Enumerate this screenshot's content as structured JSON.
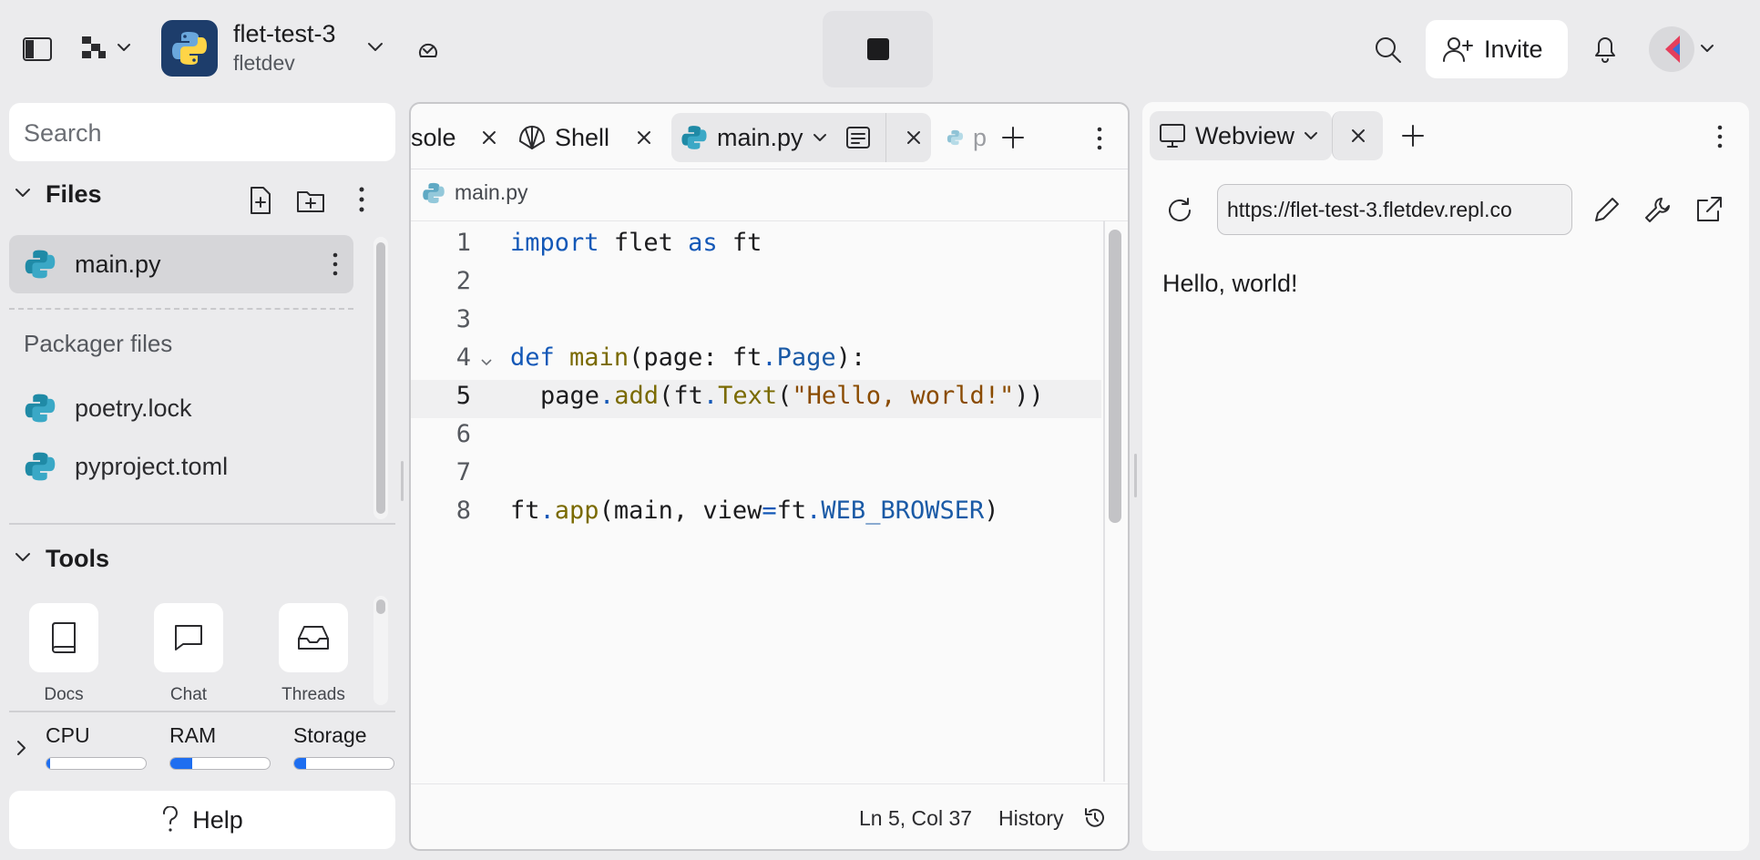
{
  "topbar": {
    "project_name": "flet-test-3",
    "owner": "fletdev",
    "invite_label": "Invite"
  },
  "sidebar": {
    "search_placeholder": "Search",
    "files_heading": "Files",
    "files": [
      {
        "name": "main.py"
      }
    ],
    "packager_heading": "Packager files",
    "packager_files": [
      {
        "name": "poetry.lock"
      },
      {
        "name": "pyproject.toml"
      }
    ],
    "tools_heading": "Tools",
    "tools": [
      {
        "label": "Docs"
      },
      {
        "label": "Chat"
      },
      {
        "label": "Threads"
      }
    ],
    "resources": [
      {
        "label": "CPU",
        "usage": 0.04
      },
      {
        "label": "RAM",
        "usage": 0.22
      },
      {
        "label": "Storage",
        "usage": 0.12
      }
    ],
    "help_label": "Help"
  },
  "editor": {
    "tabs": [
      {
        "label": "sole"
      },
      {
        "label": "Shell"
      },
      {
        "label": "main.py"
      },
      {
        "label": "p"
      }
    ],
    "breadcrumb": "main.py",
    "line_numbers": [
      "1",
      "2",
      "3",
      "4",
      "5",
      "6",
      "7",
      "8"
    ],
    "code": {
      "l1": {
        "import": "import",
        "a": "flet",
        "as": "as",
        "b": "ft"
      },
      "l4": {
        "def": "def",
        "name": "main",
        "a": "(page: ft",
        "dot": ".",
        "cls": "Page",
        "b": "):"
      },
      "l5": {
        "a": "page",
        "dot1": ".",
        "add": "add",
        "b": "(ft",
        "dot2": ".",
        "text": "Text",
        "c": "(",
        "str": "\"Hello, world!\"",
        "d": "))"
      },
      "l8": {
        "a": "ft",
        "dot1": ".",
        "app": "app",
        "b": "(main, view",
        "eq": "=",
        "c": "ft",
        "dot2": ".",
        "const": "WEB_BROWSER",
        "d": ")"
      }
    },
    "status": {
      "position": "Ln 5, Col 37",
      "history_label": "History"
    }
  },
  "webview": {
    "tab_label": "Webview",
    "url": "https://flet-test-3.fletdev.repl.co",
    "content": "Hello, world!"
  },
  "colors": {
    "background": "#ebebed",
    "panel": "#fafafa",
    "accent_blue": "#1e6ef0",
    "keyword": "#1358b7",
    "function": "#7a6a00",
    "string": "#8a4b00"
  }
}
